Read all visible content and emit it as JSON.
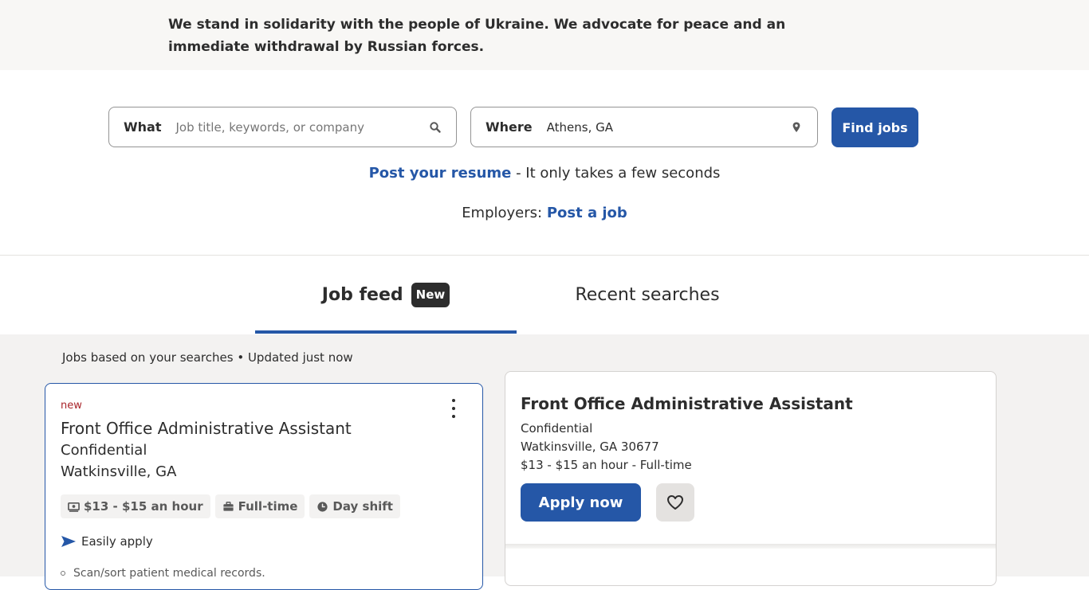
{
  "banner": {
    "text": "We stand in solidarity with the people of Ukraine. We advocate for peace and an immediate withdrawal by Russian forces."
  },
  "search": {
    "what_label": "What",
    "what_placeholder": "Job title, keywords, or company",
    "where_label": "Where",
    "where_value": "Athens, GA",
    "find_button": "Find jobs"
  },
  "resume": {
    "link": "Post your resume",
    "suffix": " - It only takes a few seconds"
  },
  "employers": {
    "prefix": "Employers: ",
    "link": "Post a job"
  },
  "tabs": {
    "job_feed": "Job feed",
    "new_badge": "New",
    "recent_searches": "Recent searches"
  },
  "feed": {
    "status": "Jobs based on your searches • Updated just now"
  },
  "job_card": {
    "tag": "new",
    "title": "Front Office Administrative Assistant",
    "company": "Confidential",
    "location": "Watkinsville, GA",
    "salary": "$13 - $15 an hour",
    "job_type": "Full-time",
    "shift": "Day shift",
    "easy_apply": "Easily apply",
    "snippet": "Scan/sort patient medical records."
  },
  "detail": {
    "title": "Front Office Administrative Assistant",
    "company": "Confidential",
    "location": "Watkinsville, GA 30677",
    "pay": "$13 - $15 an hour  - Full-time",
    "apply_button": "Apply now"
  },
  "colors": {
    "brand_blue": "#2557a7",
    "new_red": "#a9252b",
    "feed_bg": "#f3f2f1"
  }
}
